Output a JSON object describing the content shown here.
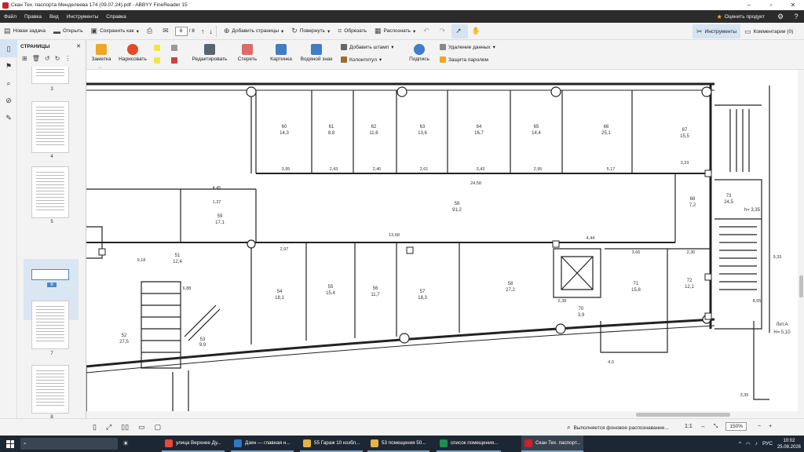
{
  "window": {
    "title": "Скан Тех. паспорта Менделеева 174 (09.07.24).pdf - ABBYY FineReader 15"
  },
  "menu": {
    "items": [
      "Файл",
      "Правка",
      "Вид",
      "Инструменты",
      "Справка"
    ],
    "rate_label": "Оценить продукт"
  },
  "toolbar": {
    "new_task": "Новая задача",
    "open": "Открыть",
    "save_as": "Сохранить как",
    "page_current": "6",
    "page_total": "/ 8",
    "add_pages": "Добавить страницы",
    "rotate": "Повернуть",
    "crop": "Обрезать",
    "recognize": "Распознать",
    "tools": "Инструменты",
    "comments": "Комментарии (0)"
  },
  "toolbar2": {
    "note": "Заметка",
    "draw": "Нарисовать",
    "edit": "Редактировать",
    "erase": "Стереть",
    "picture": "Картинка",
    "watermark": "Водяной знак",
    "add_stamp": "Добавить штамп",
    "header_footer": "Колонтитул",
    "sign": "Подпись",
    "remove_data": "Удаление данных",
    "protect": "Защита паролем"
  },
  "pages_panel": {
    "title": "СТРАНИЦЫ",
    "thumbs": [
      "3",
      "4",
      "5",
      "6",
      "7",
      "8"
    ]
  },
  "plan": {
    "top_rooms": [
      {
        "num": "60",
        "area": "14,3"
      },
      {
        "num": "61",
        "area": "8,8"
      },
      {
        "num": "62",
        "area": "11,6"
      },
      {
        "num": "63",
        "area": "13,6"
      },
      {
        "num": "64",
        "area": "16,7"
      },
      {
        "num": "65",
        "area": "14,4"
      },
      {
        "num": "66",
        "area": "25,1"
      },
      {
        "num": "67",
        "area": "15,5"
      }
    ],
    "corridor": {
      "num": "58",
      "area": "91,2"
    },
    "left_room": {
      "num": "59",
      "area": "17,1"
    },
    "bottom_rooms": [
      {
        "num": "54",
        "area": "18,1"
      },
      {
        "num": "55",
        "area": "15,4"
      },
      {
        "num": "56",
        "area": "11,7"
      },
      {
        "num": "57",
        "area": "18,3"
      },
      {
        "num": "58",
        "area": "27,2"
      },
      {
        "num": "71",
        "area": "15,8"
      },
      {
        "num": "72",
        "area": "12,1"
      }
    ],
    "misc": {
      "r51": "51",
      "r51a": "12,4",
      "r52": "52",
      "r52a": "27,5",
      "r53": "53",
      "r53a": "9,9",
      "r70": "70",
      "r70a": "3,9",
      "r68": "68",
      "r68a": "7,2",
      "r73": "73",
      "r73a": "24,5",
      "h": "h= 3,35",
      "lit": "Лит.А",
      "hlit": "Н= 5,10"
    },
    "dims": [
      "3,95",
      "2,43",
      "2,40",
      "2,61",
      "3,43",
      "2,95",
      "5,17",
      "3,23",
      "24,58",
      "4,45",
      "1,37",
      "13,68",
      "4,44",
      "3,66",
      "2,36",
      "9,18",
      "2,97",
      "6,88",
      "2,38",
      "4,0",
      "3,35",
      "9,33",
      "8,65"
    ]
  },
  "status": {
    "message": "Выполняется фоновое распознавание...",
    "ratio": "1:1",
    "zoom": "150%"
  },
  "taskbar": {
    "apps": [
      {
        "label": "улица Верхнее Ду...",
        "color": "#e8483b"
      },
      {
        "label": "Дзен — главная н...",
        "color": "#2f78c4"
      },
      {
        "label": "55 Гараж 10 козбл...",
        "color": "#e4b440"
      },
      {
        "label": "53 помещения 50...",
        "color": "#e4b440"
      },
      {
        "label": "список помещения...",
        "color": "#1f8f4e"
      },
      {
        "label": "Скан Тех. паспорт...",
        "color": "#d01f2a"
      }
    ],
    "lang": "РУС",
    "time": "10:02",
    "date": "25.08.2026"
  }
}
